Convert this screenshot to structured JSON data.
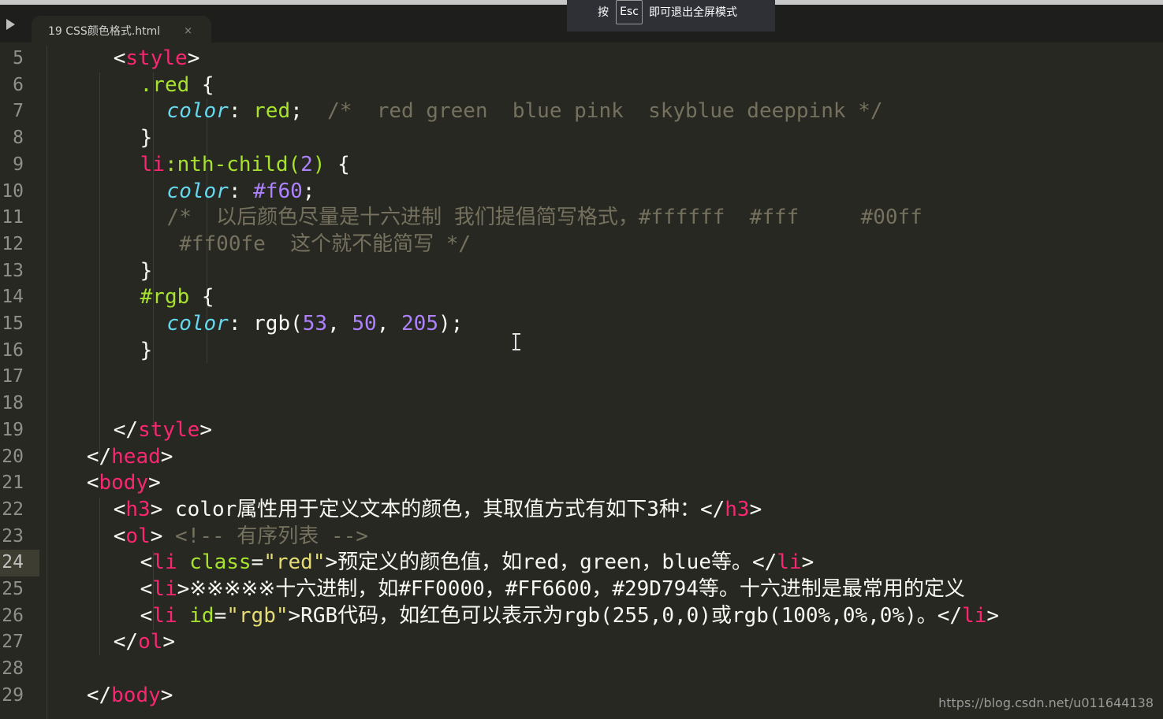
{
  "tab": {
    "title": "19 CSS颜色格式.html",
    "close_glyph": "×"
  },
  "fullscreen_tip": {
    "press": "按",
    "key": "Esc",
    "message": "即可退出全屏模式"
  },
  "gutter": {
    "line_numbers": [
      "5",
      "6",
      "7",
      "8",
      "9",
      "10",
      "11",
      "12",
      "13",
      "14",
      "15",
      "16",
      "17",
      "18",
      "19",
      "20",
      "21",
      "22",
      "23",
      "24",
      "25",
      "26",
      "27",
      "28",
      "29"
    ],
    "current_line": "24"
  },
  "code_lines": [
    {
      "indent": 5,
      "tokens": [
        {
          "t": "<",
          "c": "tx"
        },
        {
          "t": "style",
          "c": "tg"
        },
        {
          "t": ">",
          "c": "tx"
        }
      ]
    },
    {
      "indent": 7,
      "tokens": [
        {
          "t": ".red",
          "c": "at"
        },
        {
          "t": " {",
          "c": "tx"
        }
      ]
    },
    {
      "indent": 9,
      "tokens": [
        {
          "t": "color",
          "c": "pr"
        },
        {
          "t": ": ",
          "c": "tx"
        },
        {
          "t": "red",
          "c": "at"
        },
        {
          "t": ";  ",
          "c": "tx"
        },
        {
          "t": "/*  red green  blue pink  skyblue deeppink */",
          "c": "cm"
        }
      ]
    },
    {
      "indent": 7,
      "tokens": [
        {
          "t": "}",
          "c": "tx"
        }
      ]
    },
    {
      "indent": 7,
      "tokens": [
        {
          "t": "li",
          "c": "tg"
        },
        {
          "t": ":nth-child(",
          "c": "at"
        },
        {
          "t": "2",
          "c": "nm"
        },
        {
          "t": ")",
          "c": "at"
        },
        {
          "t": " {",
          "c": "tx"
        }
      ]
    },
    {
      "indent": 9,
      "tokens": [
        {
          "t": "color",
          "c": "pr"
        },
        {
          "t": ": ",
          "c": "tx"
        },
        {
          "t": "#f60",
          "c": "nm"
        },
        {
          "t": ";",
          "c": "tx"
        }
      ]
    },
    {
      "indent": 9,
      "tokens": [
        {
          "t": "/*  以后颜色尽量是十六进制 我们提倡简写格式，#ffffff  #fff     #00ff",
          "c": "cm"
        }
      ]
    },
    {
      "indent": 9,
      "tokens": [
        {
          "t": " #ff00fe  这个就不能简写 */",
          "c": "cm"
        }
      ]
    },
    {
      "indent": 7,
      "tokens": [
        {
          "t": "}",
          "c": "tx"
        }
      ]
    },
    {
      "indent": 7,
      "tokens": [
        {
          "t": "#rgb",
          "c": "at"
        },
        {
          "t": " {",
          "c": "tx"
        }
      ]
    },
    {
      "indent": 9,
      "tokens": [
        {
          "t": "color",
          "c": "pr"
        },
        {
          "t": ": ",
          "c": "tx"
        },
        {
          "t": "rgb(",
          "c": "tx"
        },
        {
          "t": "53",
          "c": "nm"
        },
        {
          "t": ", ",
          "c": "tx"
        },
        {
          "t": "50",
          "c": "nm"
        },
        {
          "t": ", ",
          "c": "tx"
        },
        {
          "t": "205",
          "c": "nm"
        },
        {
          "t": ");",
          "c": "tx"
        }
      ]
    },
    {
      "indent": 7,
      "tokens": [
        {
          "t": "}",
          "c": "tx"
        }
      ]
    },
    {
      "indent": 0,
      "tokens": []
    },
    {
      "indent": 0,
      "tokens": []
    },
    {
      "indent": 5,
      "tokens": [
        {
          "t": "</",
          "c": "tx"
        },
        {
          "t": "style",
          "c": "tg"
        },
        {
          "t": ">",
          "c": "tx"
        }
      ]
    },
    {
      "indent": 3,
      "tokens": [
        {
          "t": "</",
          "c": "tx"
        },
        {
          "t": "head",
          "c": "tg"
        },
        {
          "t": ">",
          "c": "tx"
        }
      ]
    },
    {
      "indent": 3,
      "tokens": [
        {
          "t": "<",
          "c": "tx"
        },
        {
          "t": "body",
          "c": "tg"
        },
        {
          "t": ">",
          "c": "tx"
        }
      ]
    },
    {
      "indent": 5,
      "tokens": [
        {
          "t": "<",
          "c": "tx"
        },
        {
          "t": "h3",
          "c": "tg"
        },
        {
          "t": "> color属性用于定义文本的颜色，其取值方式有如下3种：</",
          "c": "tx"
        },
        {
          "t": "h3",
          "c": "tg"
        },
        {
          "t": ">",
          "c": "tx"
        }
      ]
    },
    {
      "indent": 5,
      "tokens": [
        {
          "t": "<",
          "c": "tx"
        },
        {
          "t": "ol",
          "c": "tg"
        },
        {
          "t": "> ",
          "c": "tx"
        },
        {
          "t": "<!-- 有序列表 -->",
          "c": "cm"
        }
      ]
    },
    {
      "indent": 7,
      "tokens": [
        {
          "t": "<",
          "c": "tx"
        },
        {
          "t": "li",
          "c": "tg"
        },
        {
          "t": " ",
          "c": "tx"
        },
        {
          "t": "class",
          "c": "at"
        },
        {
          "t": "=",
          "c": "tx"
        },
        {
          "t": "\"red\"",
          "c": "st"
        },
        {
          "t": ">预定义的颜色值，如red，green，blue等。</",
          "c": "tx"
        },
        {
          "t": "li",
          "c": "tg"
        },
        {
          "t": ">",
          "c": "tx"
        }
      ]
    },
    {
      "indent": 7,
      "tokens": [
        {
          "t": "<",
          "c": "tx"
        },
        {
          "t": "li",
          "c": "tg"
        },
        {
          "t": ">※※※※※十六进制，如#FF0000，#FF6600，#29D794等。十六进制是最常用的定义",
          "c": "tx"
        }
      ]
    },
    {
      "indent": 7,
      "tokens": [
        {
          "t": "<",
          "c": "tx"
        },
        {
          "t": "li",
          "c": "tg"
        },
        {
          "t": " ",
          "c": "tx"
        },
        {
          "t": "id",
          "c": "at"
        },
        {
          "t": "=",
          "c": "tx"
        },
        {
          "t": "\"rgb\"",
          "c": "st"
        },
        {
          "t": ">RGB代码，如红色可以表示为rgb(255,0,0)或rgb(100%,0%,0%)。</",
          "c": "tx"
        },
        {
          "t": "li",
          "c": "tg"
        },
        {
          "t": ">",
          "c": "tx"
        }
      ]
    },
    {
      "indent": 5,
      "tokens": [
        {
          "t": "</",
          "c": "tx"
        },
        {
          "t": "ol",
          "c": "tg"
        },
        {
          "t": ">",
          "c": "tx"
        }
      ]
    },
    {
      "indent": 0,
      "tokens": []
    },
    {
      "indent": 3,
      "tokens": [
        {
          "t": "</",
          "c": "tx"
        },
        {
          "t": "body",
          "c": "tg"
        },
        {
          "t": ">",
          "c": "tx"
        }
      ]
    }
  ],
  "watermark": "https://blog.csdn.net/u011644138"
}
